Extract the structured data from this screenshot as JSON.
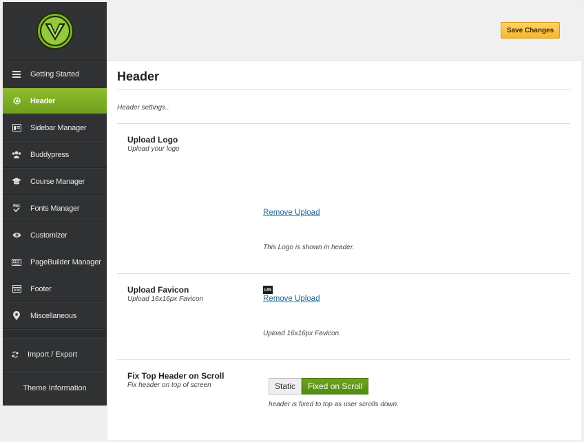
{
  "sidebar": {
    "items": [
      {
        "label": "Getting Started",
        "icon": "menu-icon"
      },
      {
        "label": "Header",
        "icon": "gear-icon",
        "active": true
      },
      {
        "label": "Sidebar Manager",
        "icon": "sidebar-icon"
      },
      {
        "label": "Buddypress",
        "icon": "users-icon"
      },
      {
        "label": "Course Manager",
        "icon": "graduation-cap-icon"
      },
      {
        "label": "Fonts Manager",
        "icon": "abc-check-icon"
      },
      {
        "label": "Customizer",
        "icon": "eye-icon"
      },
      {
        "label": "PageBuilder Manager",
        "icon": "keyboard-icon"
      },
      {
        "label": "Footer",
        "icon": "footer-icon"
      },
      {
        "label": "Miscellaneous",
        "icon": "map-pin-icon"
      }
    ],
    "import_export": "Import / Export",
    "theme_info": "Theme Information"
  },
  "toolbar": {
    "save_label": "Save Changes"
  },
  "page": {
    "title": "Header",
    "description": "Header settings.."
  },
  "sections": {
    "logo": {
      "title": "Upload Logo",
      "subtitle": "Upload your logo",
      "remove": "Remove Upload",
      "help": "This Logo is shown in header."
    },
    "favicon": {
      "title": "Upload Favicon",
      "subtitle": "Upload 16x16px Favicon",
      "preview_text": "LMS",
      "remove": "Remove Upload",
      "help": "Upload 16x16px Favicon."
    },
    "fixtop": {
      "title": "Fix Top Header on Scroll",
      "subtitle": "Fix header on top of screen",
      "option_static": "Static",
      "option_fixed": "Fixed on Scroll",
      "selected": "Fixed on Scroll",
      "help": "header is fixed to top as user scrolls down."
    }
  },
  "colors": {
    "accent": "#7cb026",
    "sidebar": "#2f3133",
    "save": "#f7bd3a"
  }
}
